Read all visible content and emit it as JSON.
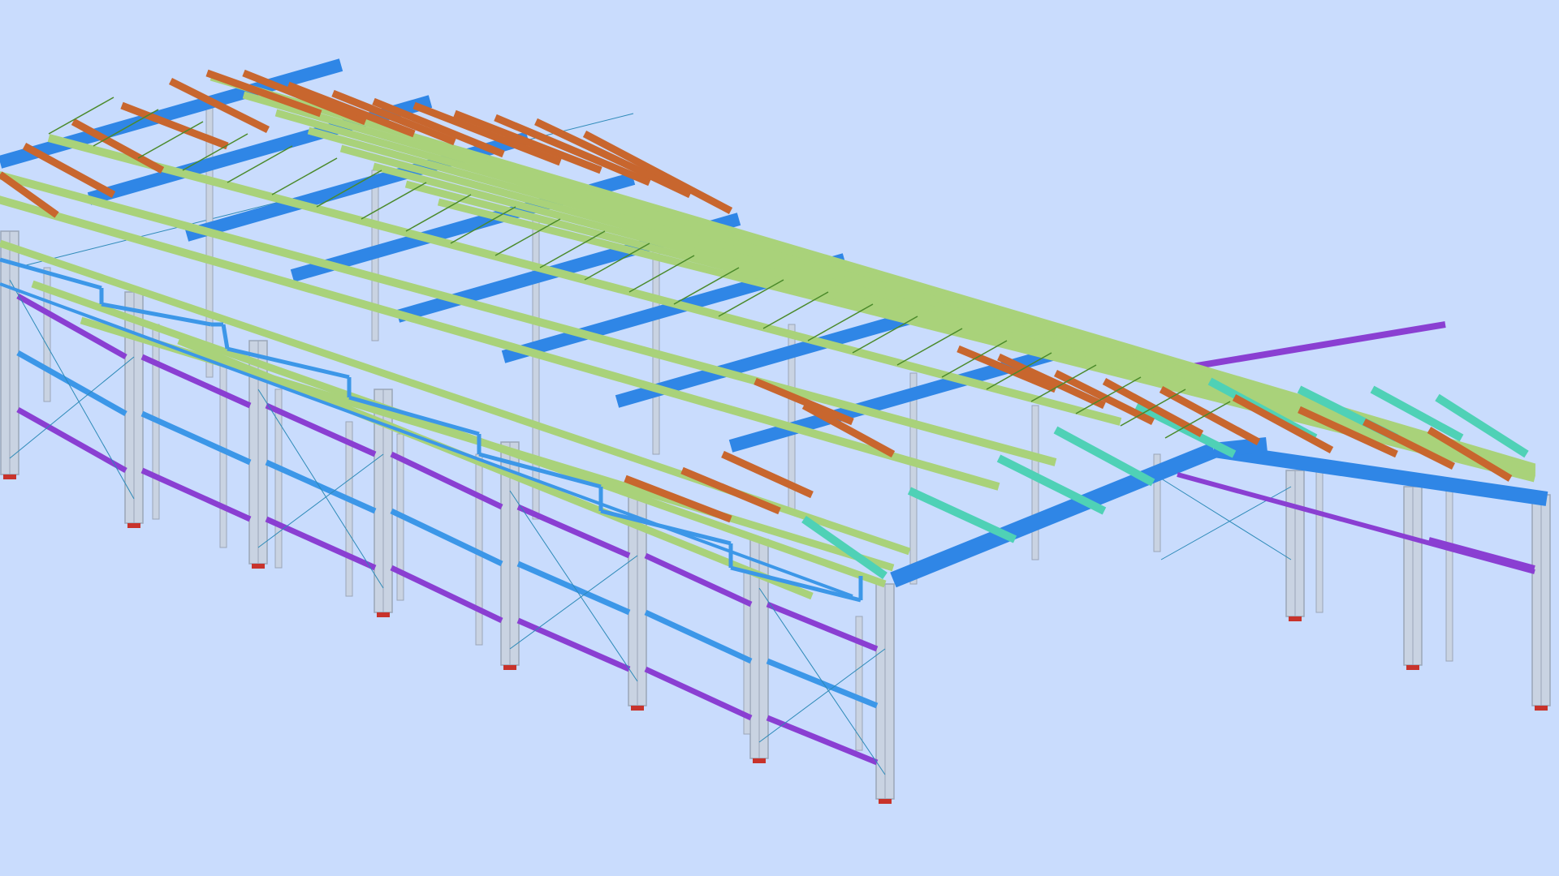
{
  "scene": {
    "view": "3d-isometric-structural-steel-model",
    "background": "#c9dcfd",
    "colors": {
      "column": "#c9d3e2",
      "column_edge": "#9aa6b8",
      "rafter": "#2f86e6",
      "eave_strut": "#3c97e8",
      "purlin": "#a9d27a",
      "purlin_teal": "#4fd1b6",
      "purlin_orange": "#c8662e",
      "girt": "#8a3fd2",
      "brace": "#2d8ab8",
      "roof_brace": "#4a8a2a",
      "base_plate": "#c8332b"
    },
    "member_types": [
      "column",
      "rafter",
      "purlin",
      "eave-strut",
      "wall-girt",
      "bracing-rod",
      "base-plate"
    ]
  }
}
